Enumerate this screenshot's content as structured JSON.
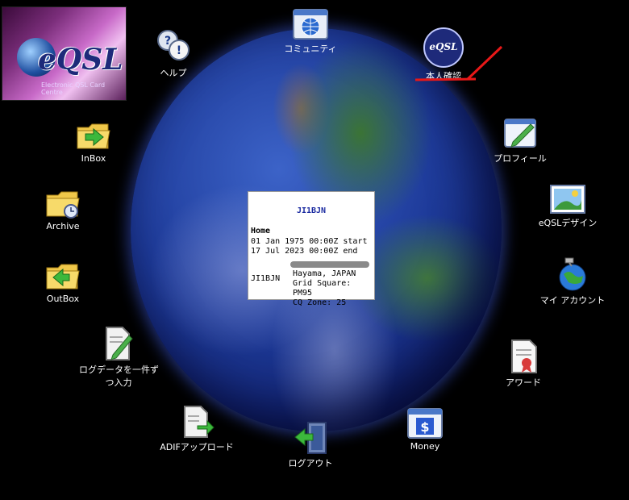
{
  "logo": {
    "brand": "eQSL",
    "subtitle": "Electronic QSL Card Centre"
  },
  "card": {
    "callsign": "JI1BJN",
    "section": "Home",
    "start": "01 Jan 1975 00:00Z start",
    "end": "17 Jul 2023 00:00Z end",
    "image_alt": "JI1BJN",
    "location": "Hayama, JAPAN",
    "grid": "Grid Square: PM95",
    "cq": "CQ Zone: 25"
  },
  "icons": {
    "help": "ヘルプ",
    "community": "コミュニティ",
    "auth": "本人確認",
    "auth_badge": "eQSL",
    "profile": "プロフィール",
    "design": "eQSLデザイン",
    "account": "マイ アカウント",
    "award": "アワード",
    "money": "Money",
    "logout": "ログアウト",
    "adif": "ADIFアップロード",
    "logentry_l1": "ログデータを一件ず",
    "logentry_l2": "つ入力",
    "outbox": "OutBox",
    "archive": "Archive",
    "inbox": "InBox"
  },
  "colors": {
    "accent_red": "#e81818",
    "globe_blue": "#1e3b9a"
  }
}
